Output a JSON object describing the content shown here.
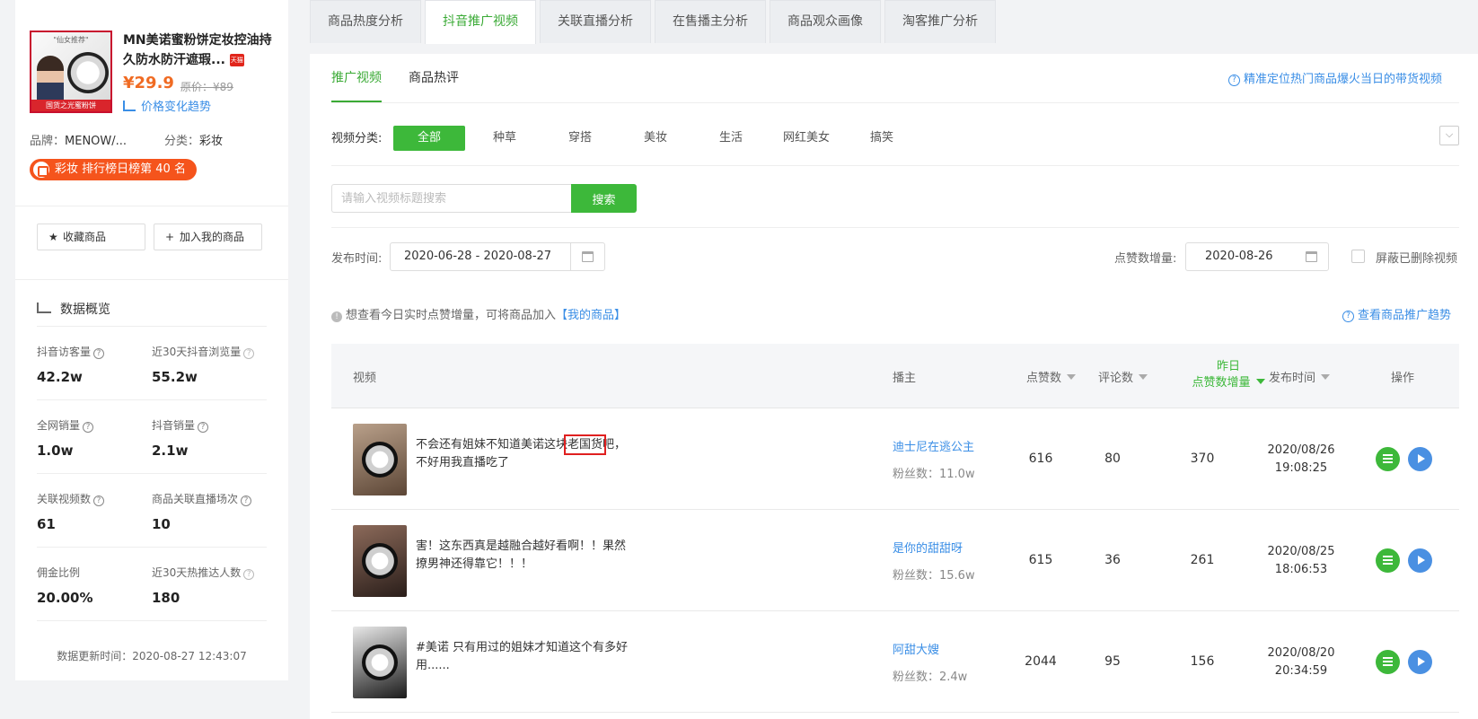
{
  "product": {
    "title": "MN美诺蜜粉饼定妆控油持久防水防汗遮瑕...",
    "tmall_badge": "天猫",
    "thumb_top_text": "\"仙女推荐\"",
    "thumb_band_text": "国货之光蜜粉饼",
    "price": "¥29.9",
    "original_price": "原价：¥89",
    "price_trend_label": "价格变化趋势",
    "brand_label": "品牌：",
    "brand_value": "MENOW/...",
    "category_label": "分类：",
    "category_value": "彩妆",
    "rank_text": "彩妆 排行榜日榜第 40 名"
  },
  "actions": {
    "favorite_label": "收藏商品",
    "add_label": "加入我的商品"
  },
  "overview": {
    "title": "数据概览",
    "stats": [
      {
        "label": "抖音访客量",
        "value": "42.2w"
      },
      {
        "label": "近30天抖音浏览量",
        "value": "55.2w"
      },
      {
        "label": "全网销量",
        "value": "1.0w"
      },
      {
        "label": "抖音销量",
        "value": "2.1w"
      },
      {
        "label": "关联视频数",
        "value": "61"
      },
      {
        "label": "商品关联直播场次",
        "value": "10"
      },
      {
        "label": "佣金比例",
        "value": "20.00%"
      },
      {
        "label": "近30天热推达人数",
        "value": "180"
      }
    ],
    "update_time": "数据更新时间：2020-08-27 12:43:07"
  },
  "tabs": [
    "商品热度分析",
    "抖音推广视频",
    "关联直播分析",
    "在售播主分析",
    "商品观众画像",
    "淘客推广分析"
  ],
  "subtabs": [
    "推广视频",
    "商品热评"
  ],
  "top_link": "精准定位热门商品爆火当日的带货视频",
  "filters": {
    "category_label": "视频分类:",
    "categories": [
      "全部",
      "种草",
      "穿搭",
      "美妆",
      "生活",
      "网红美女",
      "搞笑"
    ],
    "search_placeholder": "请输入视频标题搜索",
    "search_button": "搜索",
    "publish_label": "发布时间:",
    "publish_range": "2020-06-28 - 2020-08-27",
    "likes_label": "点赞数增量:",
    "likes_date": "2020-08-26",
    "hide_deleted": "屏蔽已删除视频"
  },
  "hint": {
    "text": "想查看今日实时点赞增量，可将商品加入",
    "link": "【我的商品】",
    "right_link": "查看商品推广趋势"
  },
  "table": {
    "headers": {
      "video": "视频",
      "anchor": "播主",
      "likes": "点赞数",
      "comments": "评论数",
      "inc_line1": "昨日",
      "inc_line2": "点赞数增量",
      "time": "发布时间",
      "ops": "操作"
    },
    "rows": [
      {
        "title_a": "不会还有姐妹不知道美诺这块",
        "title_hl": "老国货",
        "title_b": "吧，不好用我直播吃了",
        "anchor": "迪士尼在逃公主",
        "fans": "粉丝数：11.0w",
        "likes": "616",
        "comments": "80",
        "inc": "370",
        "date": "2020/08/26",
        "time": "19:08:25"
      },
      {
        "title_a": "害！这东西真是越融合越好看啊！！果然撩男神还得靠它！！！",
        "title_hl": "",
        "title_b": "",
        "anchor": "是你的甜甜呀",
        "fans": "粉丝数：15.6w",
        "likes": "615",
        "comments": "36",
        "inc": "261",
        "date": "2020/08/25",
        "time": "18:06:53"
      },
      {
        "title_a": "#美诺 只有用过的姐妹才知道这个有多好用......",
        "title_hl": "",
        "title_b": "",
        "anchor": "阿甜大嫂",
        "fans": "粉丝数：2.4w",
        "likes": "2044",
        "comments": "95",
        "inc": "156",
        "date": "2020/08/20",
        "time": "20:34:59"
      }
    ]
  },
  "colors": {
    "accent_green": "#3db83a",
    "link_blue": "#3a8ee6",
    "price_orange": "#f06b23",
    "rank_orange": "#f5541c"
  }
}
